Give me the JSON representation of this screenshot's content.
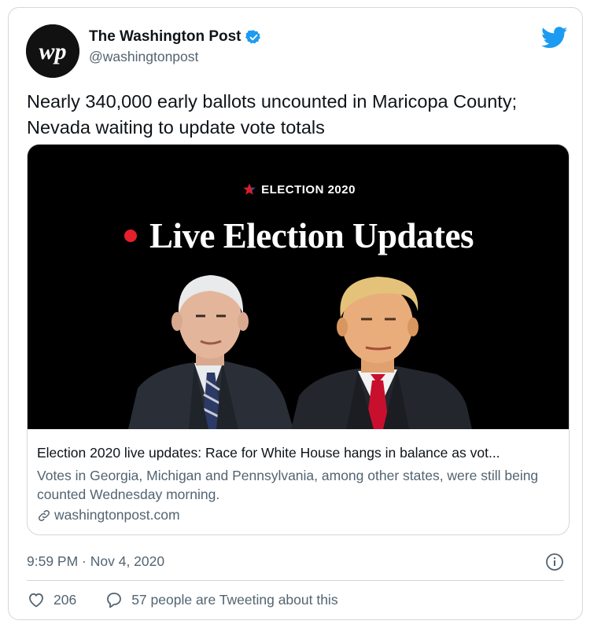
{
  "account": {
    "display_name": "The Washington Post",
    "handle": "@washingtonpost",
    "avatar_text": "wp"
  },
  "tweet": {
    "text": "Nearly 340,000 early ballots uncounted in Maricopa County; Nevada waiting to update vote totals"
  },
  "card": {
    "image": {
      "kicker": "ELECTION 2020",
      "headline": "Live Election Updates"
    },
    "title": "Election 2020 live updates: Race for White House hangs in balance as vot...",
    "description": "Votes in Georgia, Michigan and Pennsylvania, among other states, were still being counted Wednesday morning.",
    "domain": "washingtonpost.com"
  },
  "meta": {
    "timestamp": "9:59 PM · Nov 4, 2020"
  },
  "actions": {
    "likes": "206",
    "tweeting_about": "57 people are Tweeting about this"
  },
  "colors": {
    "twitter_blue": "#1d9bf0",
    "live_red": "#e4202c",
    "muted_text": "#536471",
    "border": "#cfd9de"
  }
}
